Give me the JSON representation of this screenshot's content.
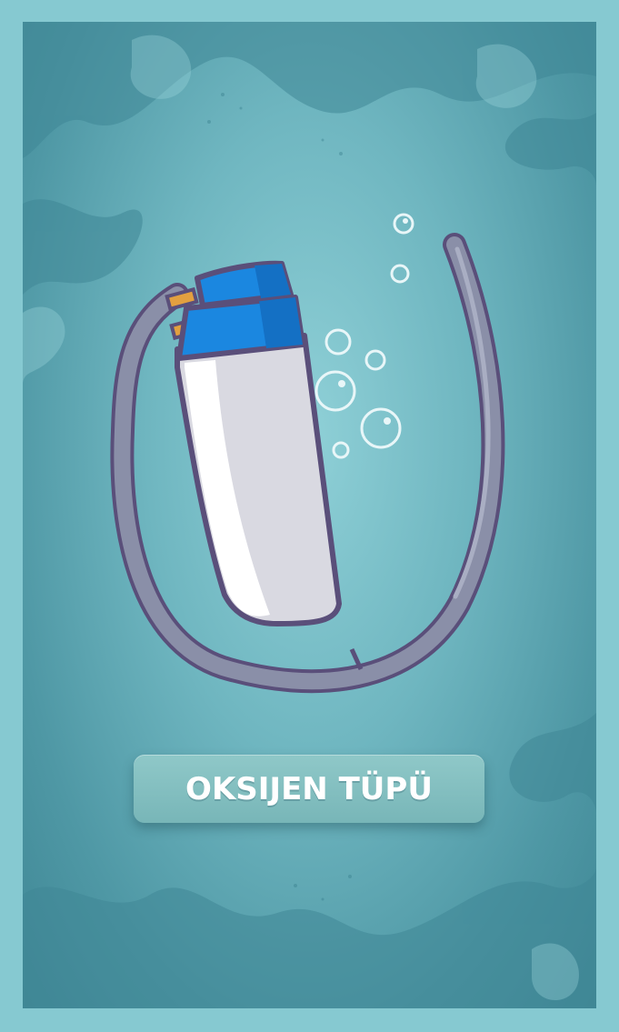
{
  "card": {
    "item_name": "OKSIJEN TÜPÜ",
    "item_icon": "oxygen-tank-icon"
  },
  "colors": {
    "frame": "#86c9d1",
    "water_light": "#8fd0d7",
    "water_dark": "#3f8795",
    "tank_blue": "#1b87e0",
    "hose": "#8a8fa8",
    "outline": "#5a4f7a"
  }
}
